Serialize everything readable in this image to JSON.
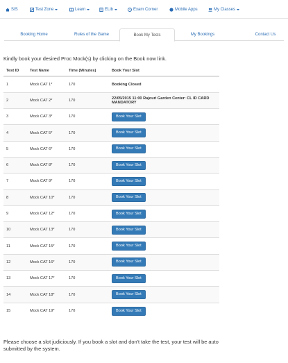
{
  "topnav": {
    "items": [
      {
        "label": "SIS",
        "icon": "home-icon",
        "caret": false
      },
      {
        "label": "Test Zone",
        "icon": "pencil-icon",
        "caret": true
      },
      {
        "label": "Learn",
        "icon": "book-icon",
        "caret": true
      },
      {
        "label": "ELib",
        "icon": "library-icon",
        "caret": true
      },
      {
        "label": "Exam Corner",
        "icon": "clock-icon",
        "caret": false
      },
      {
        "label": "Mobile Apps",
        "icon": "mobile-icon",
        "caret": false
      },
      {
        "label": "My Classes",
        "icon": "users-icon",
        "caret": true
      }
    ],
    "link_color": "#2a6db5"
  },
  "tabs": [
    {
      "label": "Booking Home",
      "active": false
    },
    {
      "label": "Rules of the Game",
      "active": false
    },
    {
      "label": "Book My Tests",
      "active": true
    },
    {
      "label": "My Bookings",
      "active": false
    },
    {
      "label": "Contact Us",
      "active": false
    }
  ],
  "intro": "Kindly book your desired Proc Mock(s) by clicking on the Book now link.",
  "table": {
    "headers": [
      "Test ID",
      "Test Name",
      "Time (Minutes)",
      "Book Your Slot"
    ],
    "rows": [
      {
        "id": "1",
        "name": "Mock CAT 1*",
        "time": "170",
        "status": "Booking Closed",
        "type": "text"
      },
      {
        "id": "2",
        "name": "Mock CAT 2*",
        "time": "170",
        "status": "22/05/2015 11:00 Rajouri Garden Center: CL ID CARD MANDATORY",
        "type": "text"
      },
      {
        "id": "3",
        "name": "Mock CAT 3*",
        "time": "170",
        "status": "Book Your Slot",
        "type": "button"
      },
      {
        "id": "4",
        "name": "Mock CAT 5*",
        "time": "170",
        "status": "Book Your Slot",
        "type": "button"
      },
      {
        "id": "5",
        "name": "Mock CAT 6*",
        "time": "170",
        "status": "Book Your Slot",
        "type": "button"
      },
      {
        "id": "6",
        "name": "Mock CAT 8*",
        "time": "170",
        "status": "Book Your Slot",
        "type": "button"
      },
      {
        "id": "7",
        "name": "Mock CAT 9*",
        "time": "170",
        "status": "Book Your Slot",
        "type": "button"
      },
      {
        "id": "8",
        "name": "Mock CAT 10*",
        "time": "170",
        "status": "Book Your Slot",
        "type": "button"
      },
      {
        "id": "9",
        "name": "Mock CAT 12*",
        "time": "170",
        "status": "Book Your Slot",
        "type": "button"
      },
      {
        "id": "10",
        "name": "Mock CAT 13*",
        "time": "170",
        "status": "Book Your Slot",
        "type": "button"
      },
      {
        "id": "11",
        "name": "Mock CAT 15*",
        "time": "170",
        "status": "Book Your Slot",
        "type": "button"
      },
      {
        "id": "12",
        "name": "Mock CAT 16*",
        "time": "170",
        "status": "Book Your Slot",
        "type": "button"
      },
      {
        "id": "13",
        "name": "Mock CAT 17*",
        "time": "170",
        "status": "Book Your Slot",
        "type": "button"
      },
      {
        "id": "14",
        "name": "Mock CAT 18*",
        "time": "170",
        "status": "Book Your Slot",
        "type": "button"
      },
      {
        "id": "15",
        "name": "Mock CAT 19*",
        "time": "170",
        "status": "Book Your Slot",
        "type": "button"
      }
    ],
    "button_color": "#337ab7"
  },
  "footer_note": "Please choose a slot judiciously. If you book a slot and don't take the test, your test will be auto submitted by the system."
}
